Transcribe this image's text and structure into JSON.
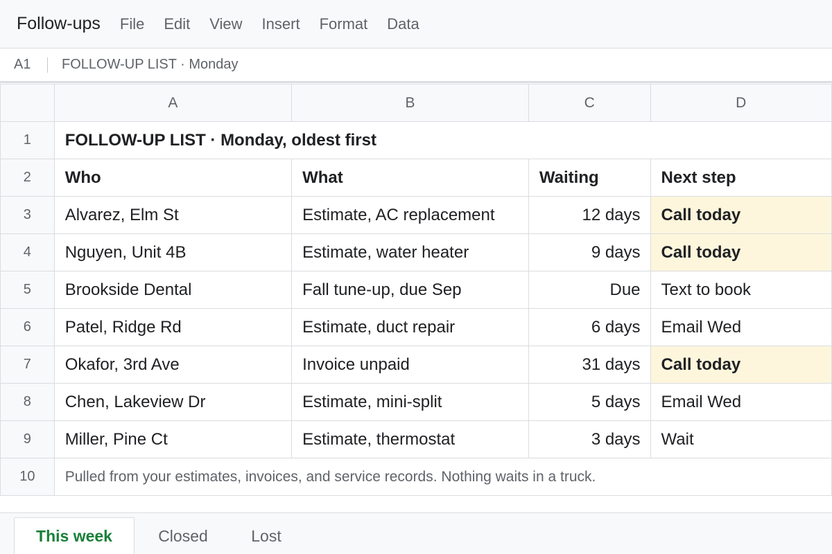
{
  "app": {
    "title": "Follow-ups"
  },
  "menu": [
    "File",
    "Edit",
    "View",
    "Insert",
    "Format",
    "Data"
  ],
  "formula_bar": {
    "cell_ref": "A1",
    "content": "FOLLOW-UP LIST · Monday"
  },
  "columns": [
    "A",
    "B",
    "C",
    "D"
  ],
  "rows": {
    "title": {
      "num": "1",
      "text": "FOLLOW-UP LIST · Monday, oldest first"
    },
    "header": {
      "num": "2",
      "who": "Who",
      "what": "What",
      "waiting": "Waiting",
      "next": "Next step"
    },
    "data": [
      {
        "num": "3",
        "who": "Alvarez, Elm St",
        "what": "Estimate, AC replacement",
        "waiting": "12 days",
        "next": "Call today",
        "highlight": true
      },
      {
        "num": "4",
        "who": "Nguyen, Unit 4B",
        "what": "Estimate, water heater",
        "waiting": "9 days",
        "next": "Call today",
        "highlight": true
      },
      {
        "num": "5",
        "who": "Brookside Dental",
        "what": "Fall tune-up, due Sep",
        "waiting": "Due",
        "next": "Text to book",
        "highlight": false
      },
      {
        "num": "6",
        "who": "Patel, Ridge Rd",
        "what": "Estimate, duct repair",
        "waiting": "6 days",
        "next": "Email Wed",
        "highlight": false
      },
      {
        "num": "7",
        "who": "Okafor, 3rd Ave",
        "what": "Invoice unpaid",
        "waiting": "31 days",
        "next": "Call today",
        "highlight": true
      },
      {
        "num": "8",
        "who": "Chen, Lakeview Dr",
        "what": "Estimate, mini-split",
        "waiting": "5 days",
        "next": "Email Wed",
        "highlight": false
      },
      {
        "num": "9",
        "who": "Miller, Pine Ct",
        "what": "Estimate, thermostat",
        "waiting": "3 days",
        "next": "Wait",
        "highlight": false
      }
    ],
    "note": {
      "num": "10",
      "text": "Pulled from your estimates, invoices, and service records. Nothing waits in a truck."
    }
  },
  "sheets": [
    {
      "label": "This week",
      "active": true
    },
    {
      "label": "Closed",
      "active": false
    },
    {
      "label": "Lost",
      "active": false
    }
  ],
  "colors": {
    "highlight": "#fdf6dc",
    "active_tab": "#188038"
  }
}
